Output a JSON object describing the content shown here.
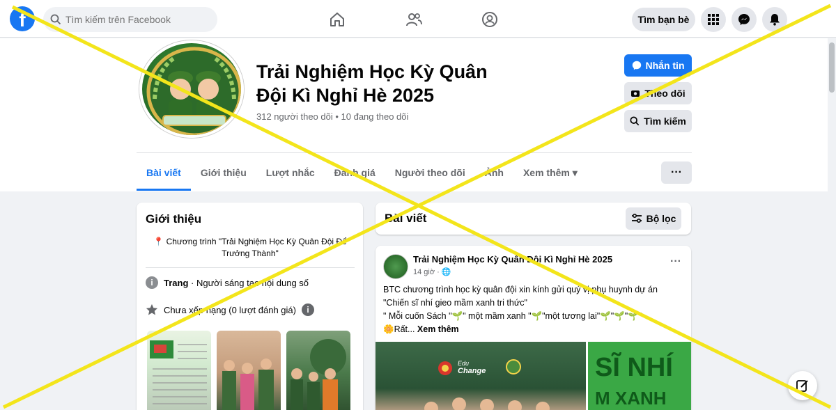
{
  "topbar": {
    "logo": "f",
    "search_placeholder": "Tìm kiếm trên Facebook",
    "find_friends": "Tìm bạn bè"
  },
  "page": {
    "title_line1": "Trải Nghiệm Học Kỳ Quân",
    "title_line2": "Đội Kì Nghỉ Hè 2025",
    "stats": "312 người theo dõi • 10 đang theo dõi",
    "message_btn": "Nhắn tin",
    "follow_btn": "Theo dõi",
    "search_btn": "Tìm kiếm"
  },
  "tabs": [
    "Bài viết",
    "Giới thiệu",
    "Lượt nhắc",
    "Đánh giá",
    "Người theo dõi",
    "Ảnh",
    "Xem thêm"
  ],
  "intro": {
    "title": "Giới thiệu",
    "bio": "Chương trình \"Trải Nghiệm Học Kỳ Quân Đội Để Trưởng Thành\"",
    "page_label": "Trang",
    "page_type": "· Người sáng tạo nội dung số",
    "rating": "Chưa xếp hạng (0 lượt đánh giá)"
  },
  "posts": {
    "title": "Bài viết",
    "filter": "Bộ lọc",
    "author": "Trải Nghiệm Học Kỳ Quân Đội Kì Nghỉ Hè 2025",
    "time": "14 giờ",
    "line1": "BTC chương trình học kỳ quân đội xin kính gửi quý vị phụ huynh dự án",
    "line2": "\"Chiến sĩ nhí gieo mầm xanh tri thức\"",
    "line3": "\" Mỗi cuốn Sách \"🌱\" một mầm xanh \"🌱\"một tương lai\"🌱\"🌱\"🌱\"",
    "line4_prefix": "🌼Rất...",
    "see_more": "Xem thêm",
    "img_right_line1": "SĨ NHÍ",
    "img_right_line2": "M XANH",
    "img_left_brand": "Edu Change"
  },
  "colors": {
    "brand": "#1877f2",
    "cross": "#f3e51b"
  }
}
